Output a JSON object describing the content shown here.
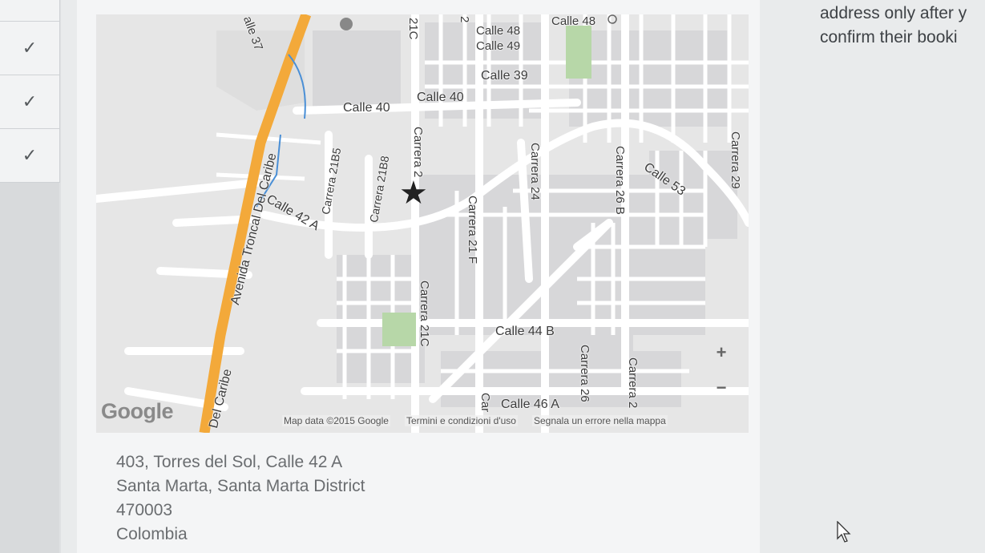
{
  "checklist": {
    "rows": [
      "check",
      "check",
      "check"
    ]
  },
  "map": {
    "streets": {
      "calle_48a": "Calle 48",
      "calle_48b": "Calle 48",
      "calle_49": "Calle 49",
      "calle_39": "Calle 39",
      "calle_40a": "Calle 40",
      "calle_40b": "Calle 40",
      "calle_42a": "Calle 42 A",
      "calle_44b": "Calle 44 B",
      "calle_46a": "Calle 46 A",
      "calle_53": "Calle 53",
      "calle_37": "alle 37",
      "carrera_21b5": "Carrera 21B5",
      "carrera_21b8": "Carrera 21B8",
      "carrera_2": "Carrera 2",
      "carrera_21c_top": "21C",
      "carrera_21c": "Carrera 21C",
      "carrera_21f": "Carrera 21 F",
      "carrera_24": "Carrera 24",
      "carrera_26b": "Carrera 26 B",
      "carrera_26": "Carrera 26",
      "carrera_29": "Carrera 29",
      "carrera_2b": "Carrera 2",
      "car": "Car",
      "num_2": "2",
      "avenida": "Avenida Troncal Del Caribe",
      "del_caribe": "Del Caribe"
    },
    "zoom_in": "+",
    "zoom_out": "−",
    "logo": "Google",
    "attribution": {
      "data": "Map data ©2015 Google",
      "terms": "Termini e condizioni d'uso",
      "report": "Segnala un errore nella mappa"
    }
  },
  "address": {
    "line1": "403, Torres del Sol, Calle 42 A",
    "line2": "Santa Marta, Santa Marta District",
    "line3": "470003",
    "line4": "Colombia"
  },
  "right_panel": {
    "line1": "address only after y",
    "line2": "confirm their booki"
  },
  "colors": {
    "map_background": "#e6e6e6",
    "road": "#ffffff",
    "highway": "#f3a93a",
    "park": "#b7d7a8",
    "water": "#4a8fd6"
  }
}
